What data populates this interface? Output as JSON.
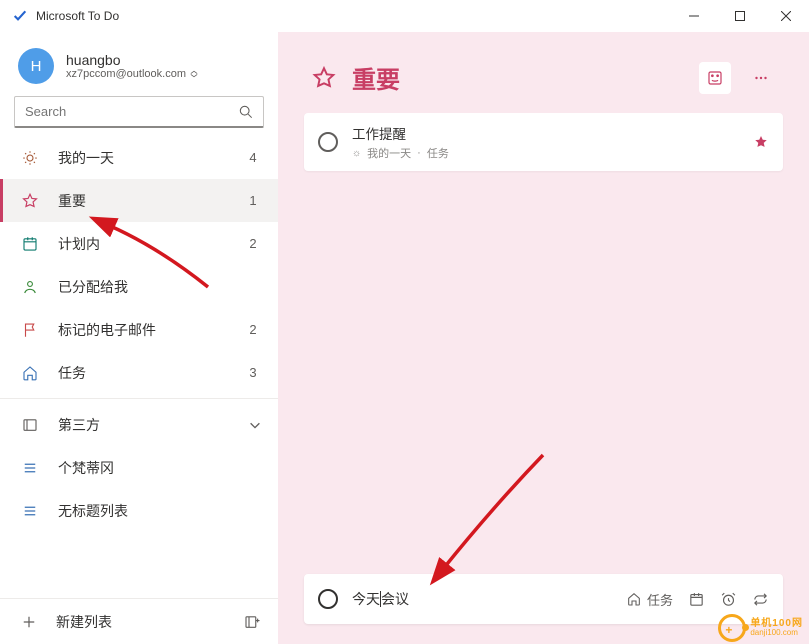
{
  "app": {
    "title": "Microsoft To Do"
  },
  "account": {
    "avatar_initial": "H",
    "name": "huangbo",
    "email": "xz7pccom@outlook.com"
  },
  "search": {
    "placeholder": "Search"
  },
  "sidebar": {
    "items": [
      {
        "label": "我的一天",
        "count": "4"
      },
      {
        "label": "重要",
        "count": "1"
      },
      {
        "label": "计划内",
        "count": "2"
      },
      {
        "label": "已分配给我",
        "count": ""
      },
      {
        "label": "标记的电子邮件",
        "count": "2"
      },
      {
        "label": "任务",
        "count": "3"
      }
    ],
    "groups": [
      {
        "label": "第三方"
      },
      {
        "label": "个梵蒂冈"
      },
      {
        "label": "无标题列表"
      }
    ],
    "new_list": "新建列表"
  },
  "main": {
    "title": "重要",
    "task": {
      "title": "工作提醒",
      "sub1": "我的一天",
      "sub2": "任务"
    },
    "add": {
      "text_before": "今天",
      "text_after": "会议",
      "suggest_label": "任务"
    }
  },
  "watermark": {
    "cn": "单机100网",
    "url": "danji100.com"
  }
}
